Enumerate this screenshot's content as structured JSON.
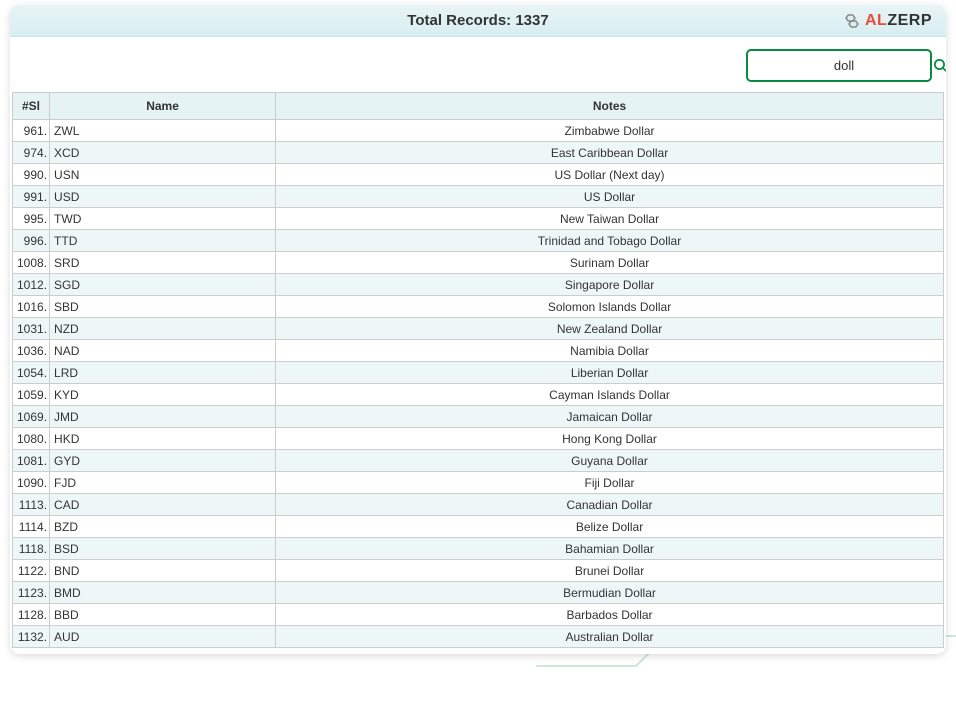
{
  "header": {
    "title": "Total Records: 1337",
    "logo_brand_al": "AL",
    "logo_brand_zerp": "ZERP"
  },
  "search": {
    "value": "doll"
  },
  "table": {
    "columns": {
      "sl": "#Sl",
      "name": "Name",
      "notes": "Notes"
    },
    "rows": [
      {
        "sl": "961.",
        "name": "ZWL",
        "notes": "Zimbabwe Dollar"
      },
      {
        "sl": "974.",
        "name": "XCD",
        "notes": "East Caribbean Dollar"
      },
      {
        "sl": "990.",
        "name": "USN",
        "notes": "US Dollar (Next day)"
      },
      {
        "sl": "991.",
        "name": "USD",
        "notes": "US Dollar"
      },
      {
        "sl": "995.",
        "name": "TWD",
        "notes": "New Taiwan Dollar"
      },
      {
        "sl": "996.",
        "name": "TTD",
        "notes": "Trinidad and Tobago Dollar"
      },
      {
        "sl": "1008.",
        "name": "SRD",
        "notes": "Surinam Dollar"
      },
      {
        "sl": "1012.",
        "name": "SGD",
        "notes": "Singapore Dollar"
      },
      {
        "sl": "1016.",
        "name": "SBD",
        "notes": "Solomon Islands Dollar"
      },
      {
        "sl": "1031.",
        "name": "NZD",
        "notes": "New Zealand Dollar"
      },
      {
        "sl": "1036.",
        "name": "NAD",
        "notes": "Namibia Dollar"
      },
      {
        "sl": "1054.",
        "name": "LRD",
        "notes": "Liberian Dollar"
      },
      {
        "sl": "1059.",
        "name": "KYD",
        "notes": "Cayman Islands Dollar"
      },
      {
        "sl": "1069.",
        "name": "JMD",
        "notes": "Jamaican Dollar"
      },
      {
        "sl": "1080.",
        "name": "HKD",
        "notes": "Hong Kong Dollar"
      },
      {
        "sl": "1081.",
        "name": "GYD",
        "notes": "Guyana Dollar"
      },
      {
        "sl": "1090.",
        "name": "FJD",
        "notes": "Fiji Dollar"
      },
      {
        "sl": "1113.",
        "name": "CAD",
        "notes": "Canadian Dollar"
      },
      {
        "sl": "1114.",
        "name": "BZD",
        "notes": "Belize Dollar"
      },
      {
        "sl": "1118.",
        "name": "BSD",
        "notes": "Bahamian Dollar"
      },
      {
        "sl": "1122.",
        "name": "BND",
        "notes": "Brunei Dollar"
      },
      {
        "sl": "1123.",
        "name": "BMD",
        "notes": "Bermudian Dollar"
      },
      {
        "sl": "1128.",
        "name": "BBD",
        "notes": "Barbados Dollar"
      },
      {
        "sl": "1132.",
        "name": "AUD",
        "notes": "Australian Dollar"
      }
    ]
  }
}
